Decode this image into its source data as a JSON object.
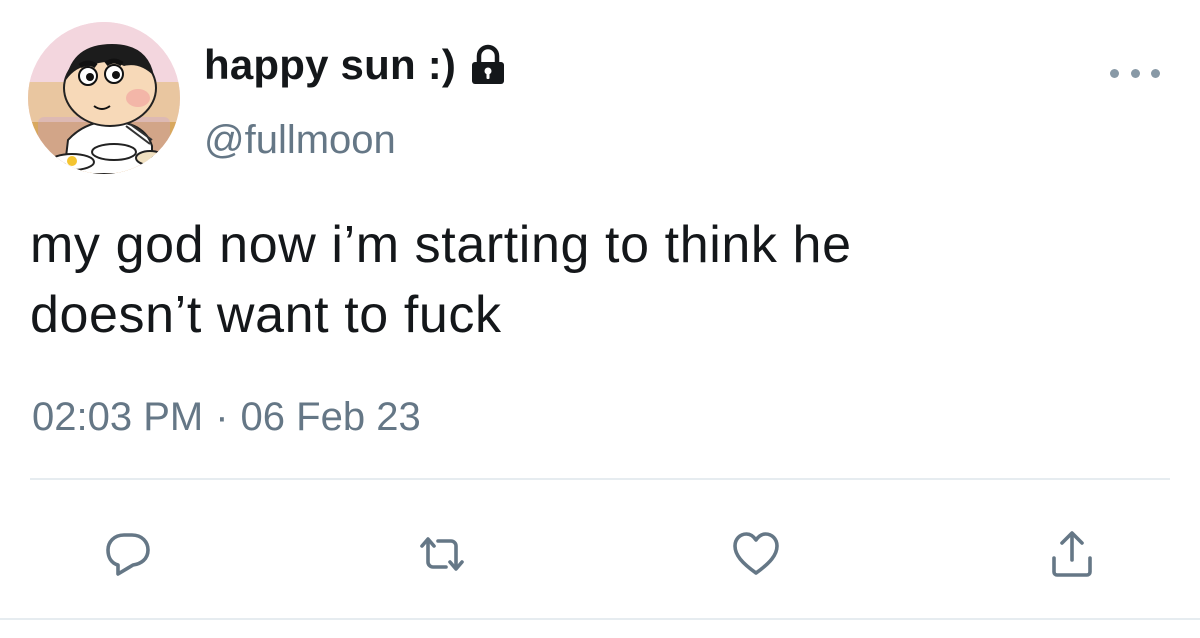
{
  "user": {
    "display_name": "happy sun :)",
    "handle": "@fullmoon",
    "protected_icon": "lock-icon",
    "avatar": "cartoon-boy-avatar"
  },
  "tweet": {
    "text_lines": [
      "my god now i’m starting to think he",
      "doesn’t want to fuck"
    ],
    "time": "02:03 PM",
    "separator": "·",
    "date": "06 Feb 23"
  },
  "actions": {
    "reply_icon": "reply-icon",
    "retweet_icon": "retweet-icon",
    "like_icon": "heart-icon",
    "share_icon": "share-icon",
    "more_icon": "more-dots-icon"
  },
  "colors": {
    "text": "#14171a",
    "secondary": "#657786",
    "icon": "#657786",
    "divider": "#e6ecf0"
  }
}
